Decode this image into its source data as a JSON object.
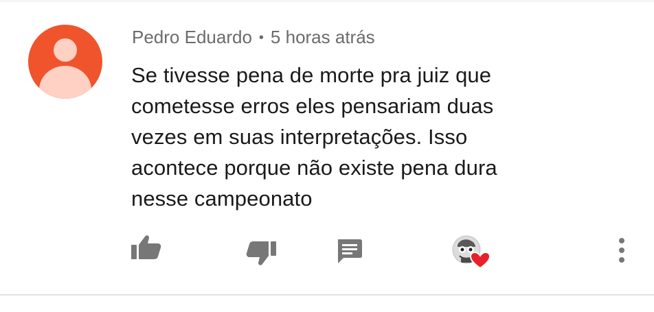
{
  "comment": {
    "author": "Pedro Eduardo",
    "separator": "•",
    "timestamp": "5 horas atrás",
    "text_lines": [
      "Se tivesse pena de morte pra juiz que",
      "cometesse erros eles pensariam duas",
      "vezes em suas interpretações. Isso",
      "acontece porque não existe pena dura",
      "nesse campeonato"
    ],
    "avatar_color": "#f0542c",
    "heart_color": "#e8202a"
  },
  "actions": {
    "like_icon": "thumb-up-icon",
    "dislike_icon": "thumb-down-icon",
    "reply_icon": "comment-icon",
    "creator_heart_icon": "creator-heart-icon",
    "more_icon": "more-vert-icon"
  }
}
